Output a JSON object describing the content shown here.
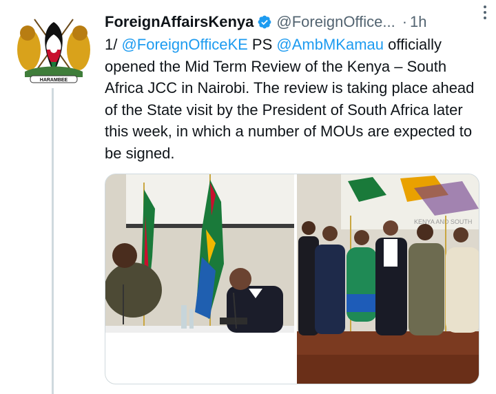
{
  "account": {
    "display_name": "ForeignAffairsKenya",
    "handle": "@ForeignOffice...",
    "separator": "·",
    "time": "1h"
  },
  "tweet": {
    "prefix": "1/ ",
    "mention1": "@ForeignOfficeKE",
    "mid": " PS ",
    "mention2": "@AmbMKamau",
    "rest": " officially opened the Mid Term Review of the Kenya – South Africa JCC in Nairobi.  The review is taking place ahead of the State visit by the President of South Africa later this week, in which a number of MOUs are expected to be signed."
  },
  "media": {
    "photo2_banner_text": "KENYA AND SOUTH"
  },
  "colors": {
    "link": "#1d9bf0",
    "verified": "#1d9bf0",
    "secondary_text": "#536471",
    "thread_line": "#cfd9de"
  },
  "icons": [
    "kenya-coat-of-arms-avatar",
    "verified-badge-icon",
    "more-options-icon"
  ]
}
